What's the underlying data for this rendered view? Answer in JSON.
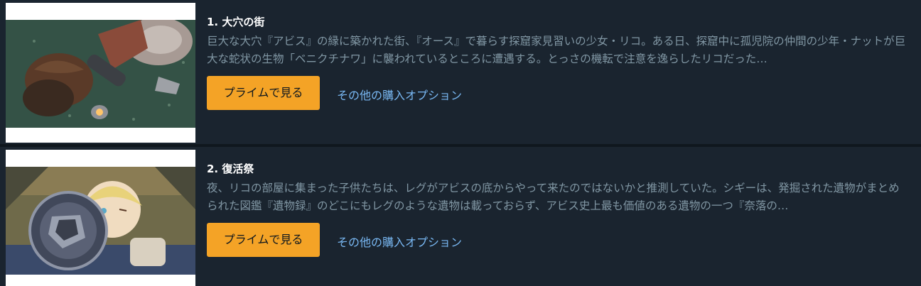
{
  "episodes": [
    {
      "title": "1. 大穴の街",
      "description": "巨大な大穴『アビス』の縁に築かれた街、『オース』で暮らす探窟家見習いの少女・リコ。ある日、探窟中に孤児院の仲間の少年・ナットが巨大な蛇状の生物「ベニクチナワ」に襲われているところに遭遇する。とっさの機転で注意を逸らしたリコだった…",
      "prime_label": "プライムで見る",
      "other_label": "その他の購入オプション",
      "thumbnail_icon": "episode-thumbnail"
    },
    {
      "title": "2. 復活祭",
      "description": "夜、リコの部屋に集まった子供たちは、レグがアビスの底からやって来たのではないかと推測していた。シギーは、発掘された遺物がまとめられた図鑑『遺物録』のどこにもレグのような遺物は載っておらず、アビス史上最も価値のある遺物の一つ『奈落の…",
      "prime_label": "プライムで見る",
      "other_label": "その他の購入オプション",
      "thumbnail_icon": "episode-thumbnail"
    }
  ],
  "colors": {
    "page_bg": "#0f171e",
    "card_bg": "#1a242f",
    "title": "#ffffff",
    "description": "#8197a4",
    "prime_button": "#f4a326",
    "link": "#79b8f3"
  }
}
